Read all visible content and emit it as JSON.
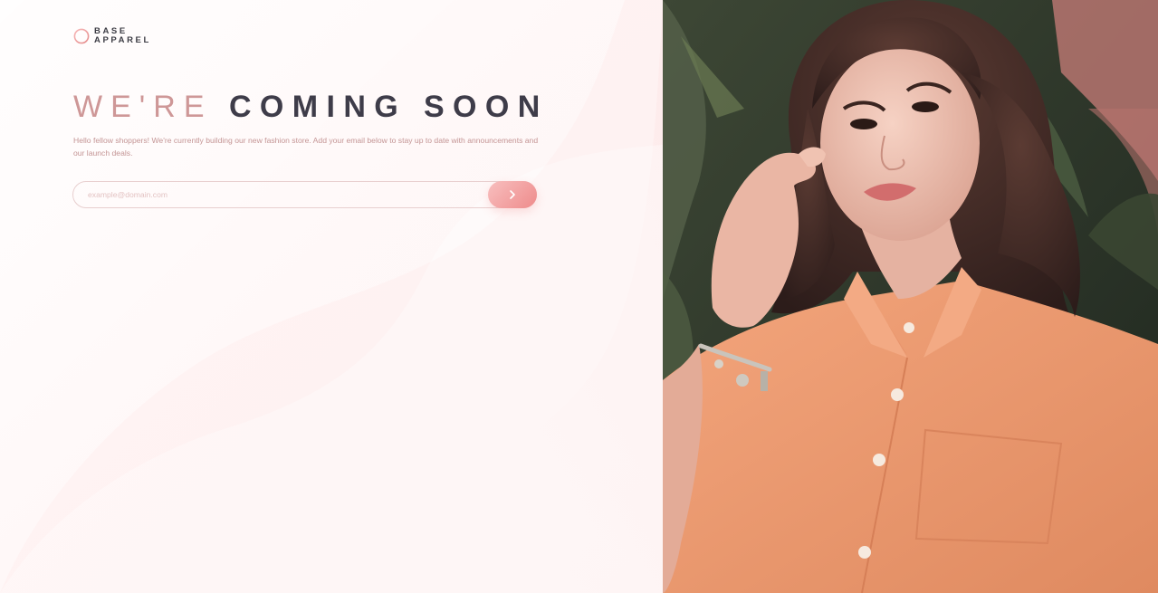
{
  "brand": {
    "line1": "BASE",
    "line2": "APPAREL",
    "accent": "#ce9797",
    "dark": "#3e3c49"
  },
  "hero_text": {
    "light": "WE'RE",
    "dark": "COMING SOON"
  },
  "description": "Hello fellow shoppers! We're currently building our new fashion store. Add your email below to stay up to date with announcements and our launch deals.",
  "form": {
    "email_placeholder": "example@domain.com",
    "submit_icon": "chevron-right-icon",
    "button_gradient": [
      "#f8bfbf",
      "#ee8b8b"
    ]
  },
  "hero_image": {
    "subject": "woman-in-orange-shirt-photo"
  }
}
